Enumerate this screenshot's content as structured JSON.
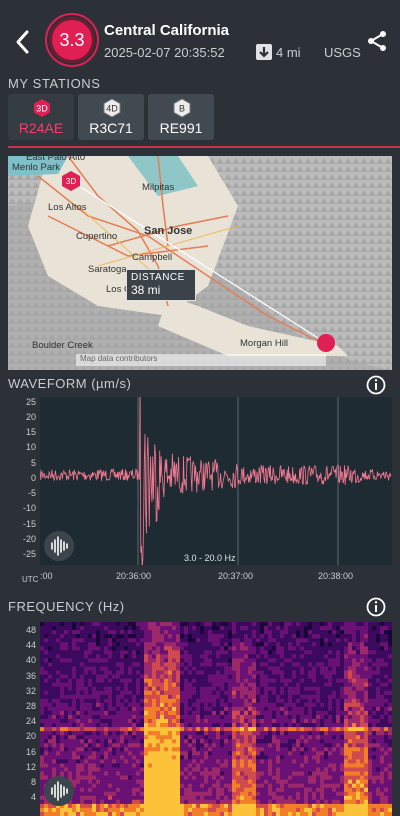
{
  "header": {
    "magnitude": "3.3",
    "region": "Central California",
    "timestamp": "2025-02-07 20:35:52",
    "depth": "4 mi",
    "source": "USGS",
    "back_icon": "chevron-left-icon",
    "share_icon": "share-icon",
    "depth_icon": "down-arrow-icon",
    "colors": {
      "accent": "#e01f54",
      "bg": "#2b3136"
    }
  },
  "stations": {
    "label": "MY STATIONS",
    "items": [
      {
        "badge": "3D",
        "name": "R24AE",
        "active": true
      },
      {
        "badge": "4D",
        "name": "R3C71",
        "active": false
      },
      {
        "badge": "B",
        "name": "RE991",
        "active": false
      }
    ]
  },
  "map": {
    "places": [
      "East Palo Alto",
      "Menlo Park",
      "Milpitas",
      "Los Altos",
      "San Jose",
      "Cupertino",
      "Campbell",
      "Saratoga",
      "Morgan Hill",
      "Boulder Creek",
      "Los Gatos"
    ],
    "station_badge": "3D",
    "distance_label": "DISTANCE",
    "distance_value": "38 mi",
    "attribution": "Map data contributors"
  },
  "waveform": {
    "title": "WAVEFORM (µm/s)",
    "y_ticks": [
      "25",
      "20",
      "15",
      "10",
      "5",
      "0",
      "-5",
      "-10",
      "-15",
      "-20",
      "-25"
    ],
    "x_ticks": [
      ":00",
      "20:36:00",
      "20:37:00",
      "20:38:00"
    ],
    "utc_label": "UTC",
    "band": "3.0 - 20.0 Hz",
    "info_icon": "info-icon",
    "sound_icon": "waveform-sound-icon"
  },
  "frequency": {
    "title": "FREQUENCY (Hz)",
    "y_ticks": [
      "48",
      "44",
      "40",
      "36",
      "32",
      "28",
      "24",
      "20",
      "16",
      "12",
      "8",
      "4"
    ],
    "info_icon": "info-icon",
    "sound_icon": "waveform-sound-icon"
  }
}
